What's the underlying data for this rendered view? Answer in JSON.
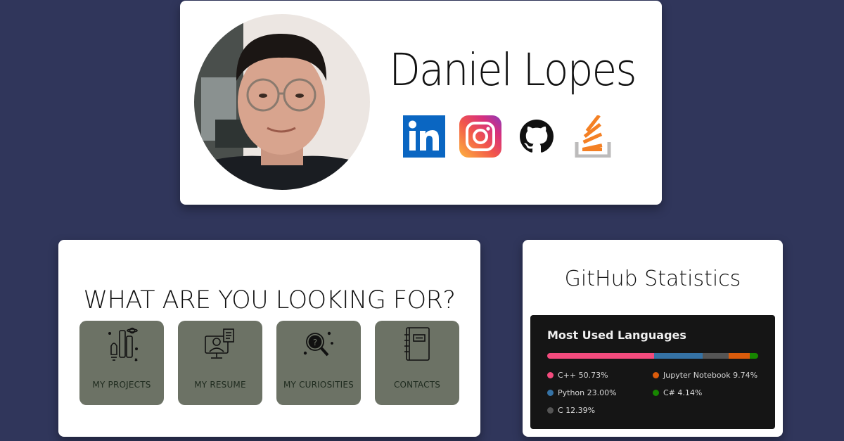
{
  "profile": {
    "name": "Daniel Lopes",
    "photo": "profile-photo",
    "social": [
      {
        "icon": "linkedin-icon",
        "color": "#0a66c2"
      },
      {
        "icon": "instagram-icon",
        "color": "#e1306c"
      },
      {
        "icon": "github-icon",
        "color": "#111111"
      },
      {
        "icon": "stackoverflow-icon",
        "color": "#f48024"
      }
    ]
  },
  "looking": {
    "title": "WHAT ARE YOU LOOKING FOR?",
    "tiles": [
      {
        "label": "MY PROJECTS",
        "icon": "rocket-space-icon"
      },
      {
        "label": "MY RESUME",
        "icon": "resume-monitor-icon"
      },
      {
        "label": "MY CURIOSITIES",
        "icon": "magnifier-question-icon"
      },
      {
        "label": "CONTACTS",
        "icon": "address-book-icon"
      }
    ],
    "tile_color": "#6c7265"
  },
  "github": {
    "title": "GitHub Statistics",
    "panel_title": "Most Used Languages",
    "languages": [
      {
        "name": "C++",
        "percent": "50.73%",
        "value": 50.73,
        "color": "#f34b7d"
      },
      {
        "name": "Python",
        "percent": "23.00%",
        "value": 23.0,
        "color": "#3572a5"
      },
      {
        "name": "C",
        "percent": "12.39%",
        "value": 12.39,
        "color": "#555555"
      },
      {
        "name": "Jupyter Notebook",
        "percent": "9.74%",
        "value": 9.74,
        "color": "#da5b0b"
      },
      {
        "name": "C#",
        "percent": "4.14%",
        "value": 4.14,
        "color": "#178600"
      }
    ]
  },
  "colors": {
    "background": "#30365b",
    "card": "#ffffff",
    "panel": "#151515"
  }
}
